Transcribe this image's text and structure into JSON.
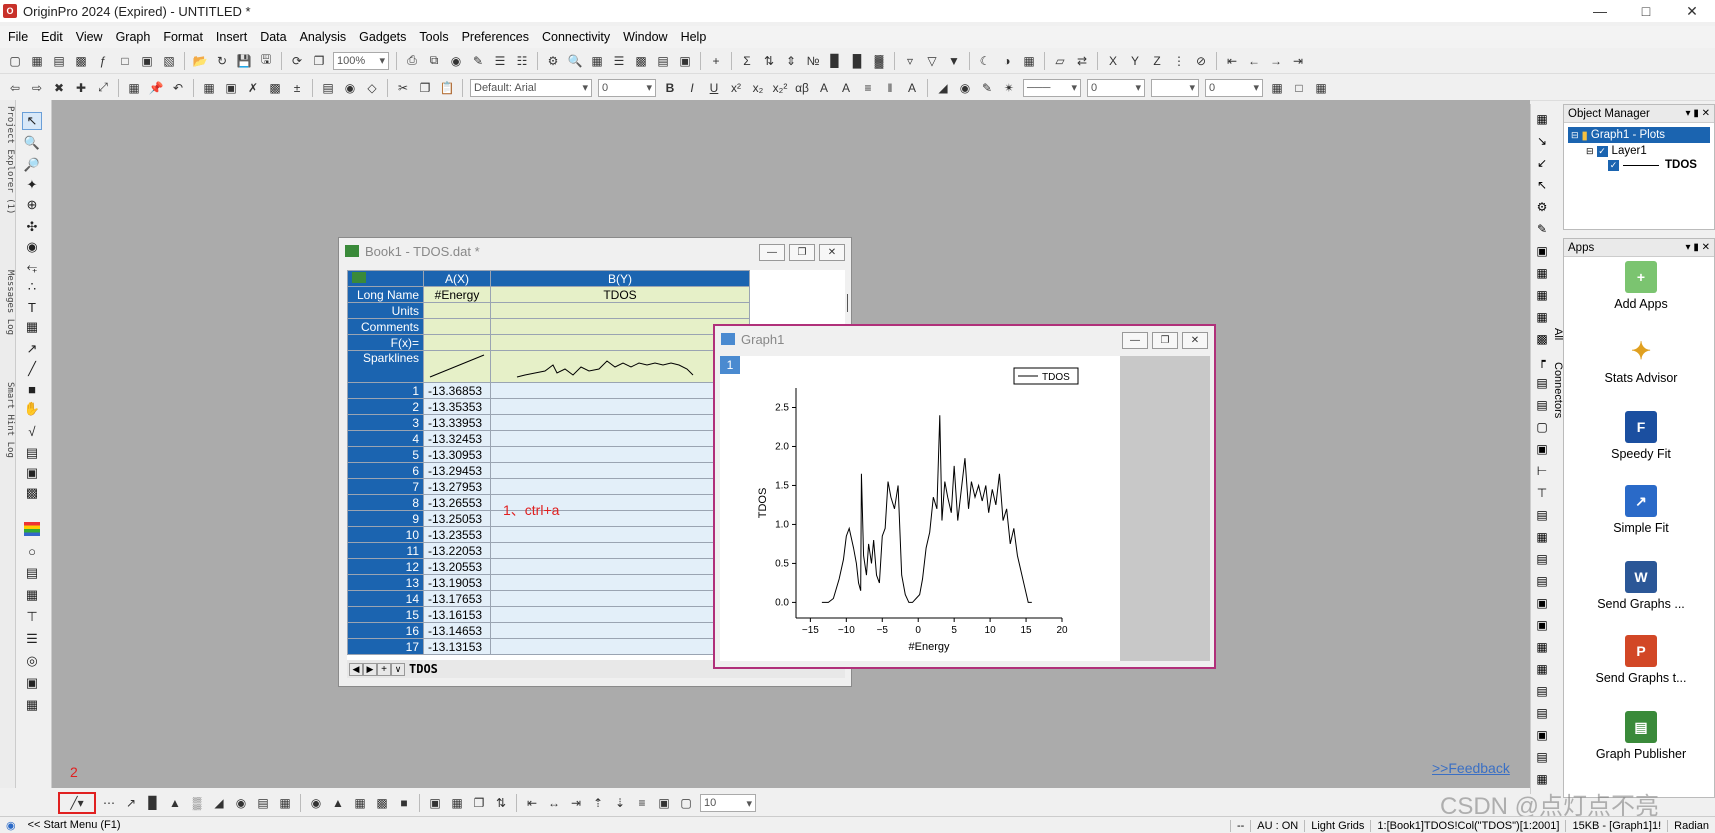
{
  "app": {
    "title": "OriginPro 2024 (Expired) - UNTITLED *"
  },
  "menu": [
    "File",
    "Edit",
    "View",
    "Graph",
    "Format",
    "Insert",
    "Data",
    "Analysis",
    "Gadgets",
    "Tools",
    "Preferences",
    "Connectivity",
    "Window",
    "Help"
  ],
  "toolbar": {
    "zoom": "100%",
    "font": "Default: Arial",
    "fontsize": "0",
    "linewidth": "0",
    "size2": "0",
    "bottom_zoom": "10"
  },
  "sidelabels": [
    "Project Explorer (1)",
    "Messages Log",
    "Smart Hint Log"
  ],
  "workbook": {
    "title": "Book1 - TDOS.dat *",
    "colA": "A(X)",
    "colB": "B(Y)",
    "meta_labels": [
      "Long Name",
      "Units",
      "Comments",
      "F(x)=",
      "Sparklines"
    ],
    "longA": "#Energy",
    "longB": "TDOS",
    "rows": [
      [
        "1",
        "-13.36853"
      ],
      [
        "2",
        "-13.35353"
      ],
      [
        "3",
        "-13.33953"
      ],
      [
        "4",
        "-13.32453"
      ],
      [
        "5",
        "-13.30953"
      ],
      [
        "6",
        "-13.29453"
      ],
      [
        "7",
        "-13.27953"
      ],
      [
        "8",
        "-13.26553"
      ],
      [
        "9",
        "-13.25053"
      ],
      [
        "10",
        "-13.23553"
      ],
      [
        "11",
        "-13.22053"
      ],
      [
        "12",
        "-13.20553"
      ],
      [
        "13",
        "-13.19053"
      ],
      [
        "14",
        "-13.17653"
      ],
      [
        "15",
        "-13.16153"
      ],
      [
        "16",
        "-13.14653"
      ],
      [
        "17",
        "-13.13153"
      ]
    ],
    "sheet_tab": "TDOS",
    "annotation": "1、ctrl+a"
  },
  "graph": {
    "title": "Graph1",
    "layer_badge": "1"
  },
  "chart_data": {
    "type": "line",
    "xlabel": "#Energy",
    "ylabel": "TDOS",
    "xlim": [
      -17,
      20
    ],
    "ylim": [
      -0.2,
      2.75
    ],
    "xticks": [
      -15,
      -10,
      -5,
      0,
      5,
      10,
      15,
      20
    ],
    "yticks": [
      0.0,
      0.5,
      1.0,
      1.5,
      2.0,
      2.5
    ],
    "xtick_labels": [
      "−15",
      "−10",
      "−5",
      "0",
      "5",
      "10",
      "15",
      "20"
    ],
    "ytick_labels": [
      "0.0",
      "0.5",
      "1.0",
      "1.5",
      "2.0",
      "2.5"
    ],
    "series": [
      {
        "name": "TDOS",
        "x": [
          -13.4,
          -12.5,
          -11.8,
          -11.0,
          -10.4,
          -10.0,
          -9.6,
          -9.0,
          -8.6,
          -8.3,
          -8.0,
          -7.9,
          -7.6,
          -7.2,
          -6.9,
          -6.5,
          -6.2,
          -5.8,
          -5.4,
          -5.0,
          -4.6,
          -4.2,
          -3.8,
          -3.3,
          -2.8,
          -2.3,
          -1.8,
          -1.3,
          -0.8,
          -0.3,
          0.2,
          0.6,
          1.1,
          1.6,
          2.1,
          2.6,
          3.0,
          3.3,
          3.7,
          4.1,
          4.6,
          5.0,
          5.5,
          6.0,
          6.5,
          7.0,
          7.4,
          7.9,
          8.4,
          8.9,
          9.4,
          9.8,
          10.3,
          10.8,
          11.3,
          11.8,
          12.3,
          12.8,
          13.3,
          13.8,
          14.3,
          14.8,
          15.3,
          15.8
        ],
        "y": [
          0.0,
          0.0,
          0.05,
          0.3,
          0.55,
          0.85,
          0.95,
          0.7,
          0.5,
          0.25,
          0.15,
          1.65,
          0.6,
          0.35,
          0.75,
          0.5,
          0.8,
          0.35,
          0.25,
          0.85,
          0.95,
          1.55,
          1.35,
          1.2,
          1.5,
          0.35,
          0.1,
          0.0,
          0.0,
          0.05,
          0.1,
          0.3,
          0.7,
          0.9,
          1.35,
          1.2,
          2.4,
          1.05,
          1.55,
          1.35,
          1.15,
          1.75,
          1.05,
          1.45,
          1.85,
          1.2,
          1.55,
          1.35,
          1.5,
          1.3,
          1.5,
          1.15,
          1.45,
          1.25,
          1.65,
          1.05,
          1.2,
          0.75,
          0.95,
          0.6,
          0.4,
          0.2,
          0.0,
          0.0
        ]
      }
    ],
    "legend": "top-right"
  },
  "objmgr": {
    "title": "Object Manager",
    "graph": "Graph1 - Plots",
    "layer": "Layer1",
    "plot": "TDOS"
  },
  "apps": {
    "title": "Apps",
    "items": [
      "Add Apps",
      "Stats Advisor",
      "Speedy Fit",
      "Simple Fit",
      "Send Graphs ...",
      "Send Graphs t...",
      "Graph Publisher"
    ],
    "tab_all": "All",
    "tab_conn": "Connectors"
  },
  "feedback": ">>Feedback",
  "step2": "2",
  "watermark": "CSDN @点灯点不亮",
  "status": {
    "left": "<< Start Menu (F1)",
    "items": [
      "--",
      "AU : ON",
      "Light Grids",
      "1:[Book1]TDOS!Col(\"TDOS\")[1:2001]",
      "15KB - [Graph1]1!",
      "Radian"
    ]
  },
  "colors": {
    "accent": "#1b64b0",
    "annotation": "#e02020",
    "graphborder": "#b0307a"
  }
}
